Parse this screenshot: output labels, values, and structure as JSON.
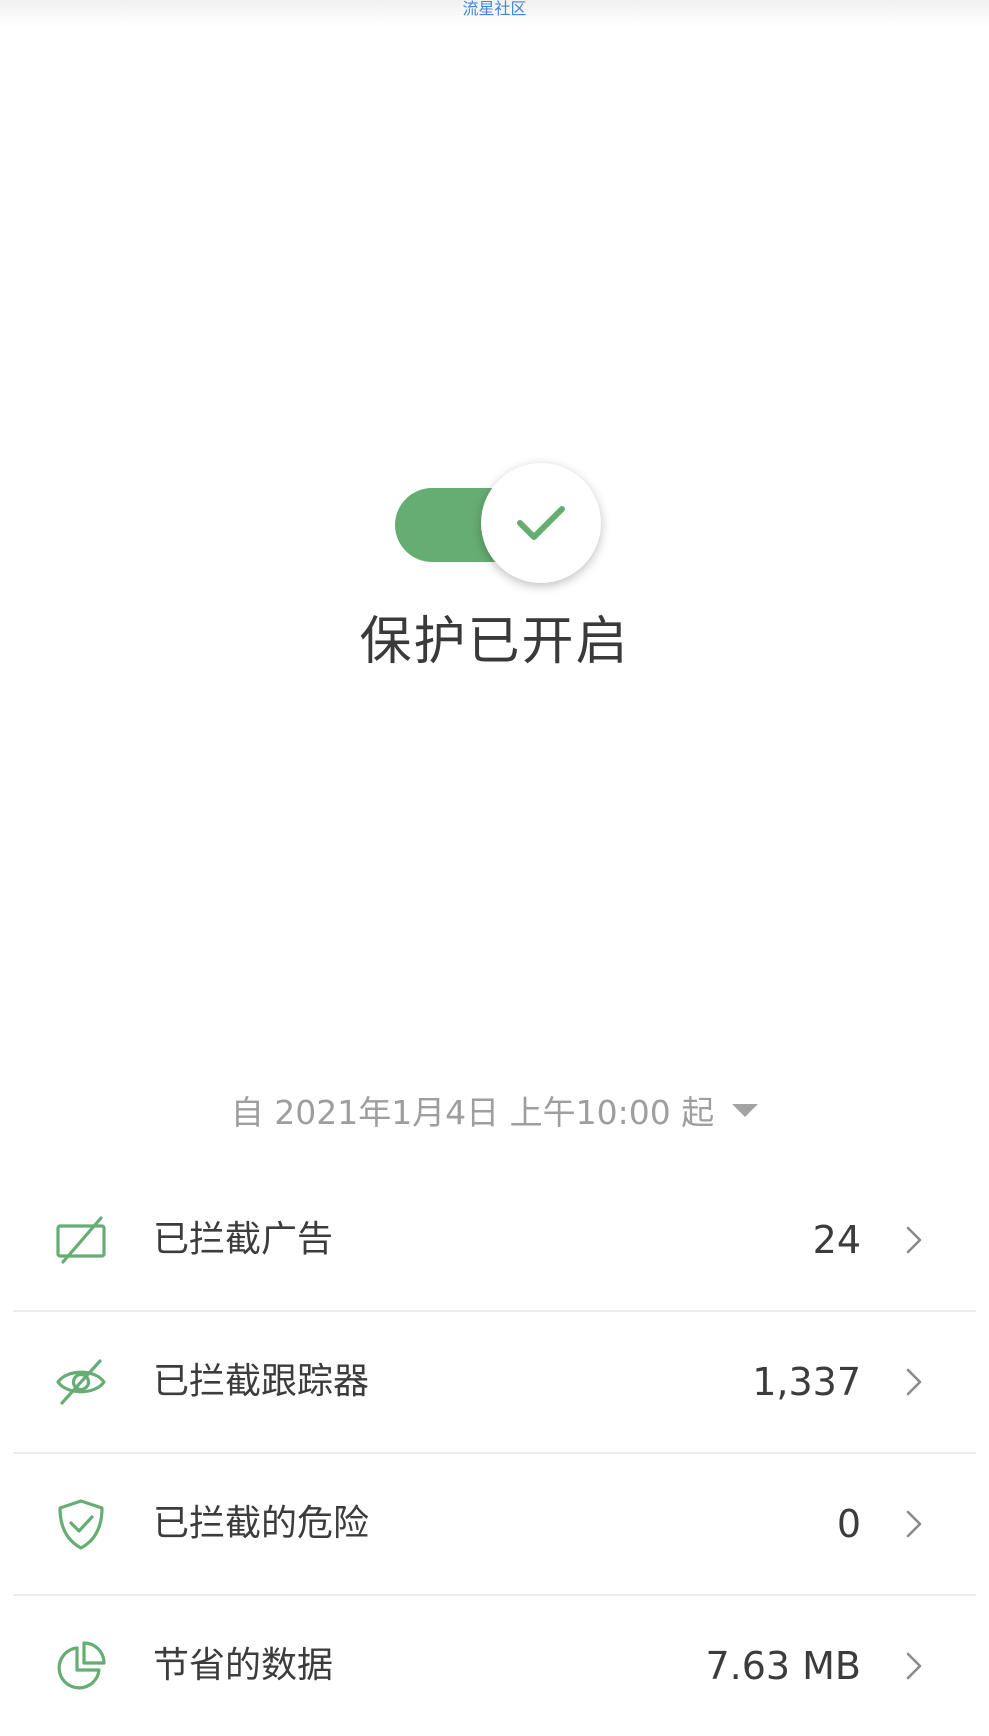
{
  "watermark": "流星社区",
  "protection": {
    "status": "保护已开启",
    "enabled": true,
    "accent_color": "#66ad73"
  },
  "since_selector": {
    "label": "自 2021年1月4日 上午10:00 起",
    "caret_icon": "caret-down-icon"
  },
  "stats": [
    {
      "icon": "ad-blocked-icon",
      "label": "已拦截广告",
      "value": "24"
    },
    {
      "icon": "eye-off-icon",
      "label": "已拦截跟踪器",
      "value": "1,337"
    },
    {
      "icon": "shield-check-icon",
      "label": "已拦截的危险",
      "value": "0"
    },
    {
      "icon": "pie-chart-icon",
      "label": "节省的数据",
      "value": "7.63 MB"
    }
  ]
}
